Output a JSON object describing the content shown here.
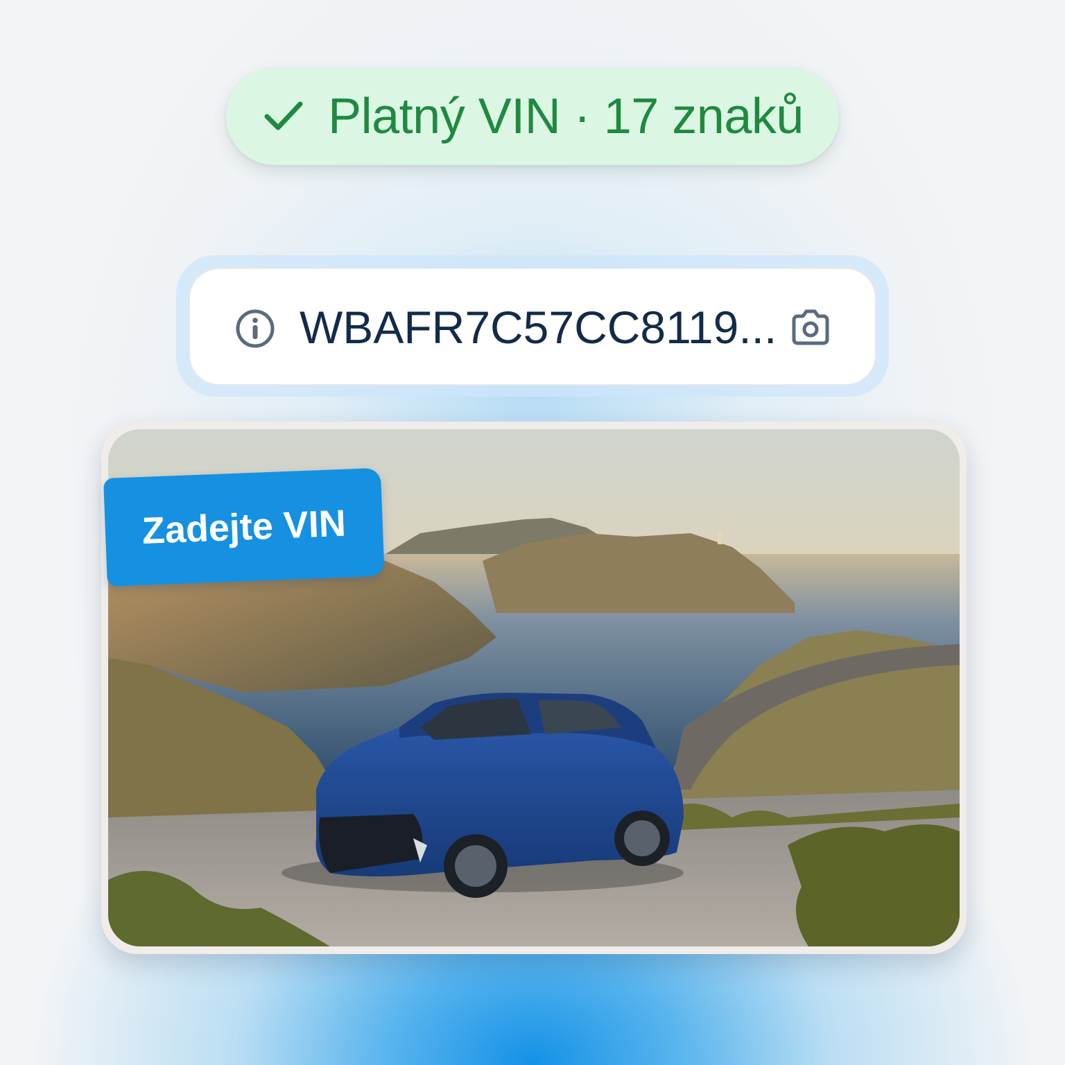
{
  "status": {
    "text": "Platný VIN · 17 znaků",
    "icon": "check-icon",
    "color": "#1f8a3f",
    "background": "#dcf6e4"
  },
  "vin_input": {
    "value": "WBAFR7C57CC8119...",
    "leading_icon": "info-icon",
    "trailing_icon": "camera-icon"
  },
  "photo": {
    "badge_label": "Zadejte VIN",
    "accent": "#1691e1"
  }
}
